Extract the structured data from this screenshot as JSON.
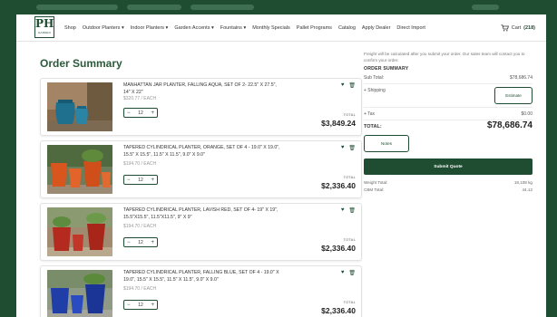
{
  "brand": {
    "logo_text": "PH",
    "logo_subtext": "GARDEN"
  },
  "nav": {
    "items": [
      "Shop",
      "Outdoor Planters ▾",
      "Indoor Planters ▾",
      "Garden Accents ▾",
      "Fountains ▾",
      "Monthly Specials",
      "Pallet Programs",
      "Catalog",
      "Apply Dealer",
      "Direct Import"
    ],
    "cart_icon": "cart-icon",
    "cart_label": "Cart",
    "cart_count": "(218)"
  },
  "page_title": "Order Summary",
  "items": [
    {
      "name": "MANHATTAN JAR PLANTER, FALLING AQUA, SET OF 2- 22.5\" X 27.5\", 14\" X 22\"",
      "price": "$320.77 / EACH",
      "qty": "12",
      "total_label": "TOTAL",
      "total": "$3,849.24"
    },
    {
      "name": "TAPERED CYLINDRICAL PLANTER, ORANGE, SET OF 4 - 19.0\" X 19.0\", 15.5\" X 15.5\", 11.5\" X 11.5\", 9.0\" X 9.0\"",
      "price": "$194.70 / EACH",
      "qty": "12",
      "total_label": "TOTAL",
      "total": "$2,336.40"
    },
    {
      "name": "TAPERED CYLINDRICAL PLANTER, LAVISH RED, SET OF 4- 19\" X 19\", 15.5\"x15.5\", 11.5\"x11.5\", 9\" X 9\"",
      "price": "$194.70 / EACH",
      "qty": "12",
      "total_label": "TOTAL",
      "total": "$2,336.40"
    },
    {
      "name": "TAPERED CYLINDRICAL PLANTER, FALLING BLUE, SET OF 4 - 19.0\" X 19.0\", 15.5\" X 15.5\", 11.5\" X 11.5\", 9.0\" X 9.0\"",
      "price": "$194.70 / EACH",
      "qty": "12",
      "total_label": "TOTAL",
      "total": "$2,336.40"
    }
  ],
  "summary": {
    "note": "Freight will be calculated after you submit your order. Our sales team will contact you to confirm your order.",
    "heading": "ORDER SUMMARY",
    "subtotal_label": "Sub Total:",
    "subtotal_value": "$78,686.74",
    "shipping_label": "+ Shipping",
    "estimate_label": "Estimate",
    "tax_label": "+ Tax",
    "tax_value": "$0.00",
    "total_label": "TOTAL:",
    "total_value": "$78,686.74",
    "notes_label": "Notes",
    "submit_label": "Submit Quote",
    "weight_label": "Weight Total:",
    "weight_value": "18,108 kg",
    "cbm_label": "CBM Total:",
    "cbm_value": "44.12"
  },
  "colors": {
    "brand_green": "#1f4d31",
    "title_green": "#2a5a3a",
    "aqua": "#1f6f8f",
    "orange": "#d8551e",
    "red": "#b52a1e",
    "blue": "#1f3ea8"
  }
}
